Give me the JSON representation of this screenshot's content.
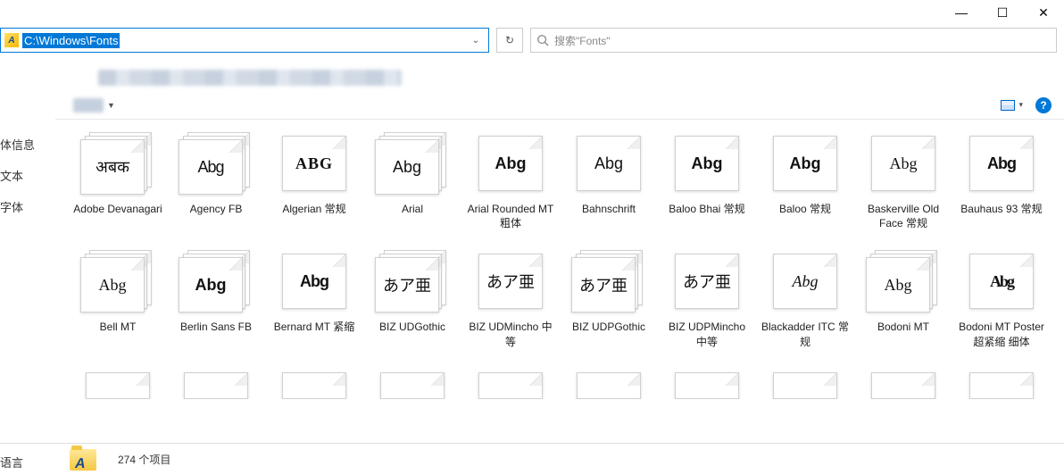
{
  "window": {
    "minimize": "—",
    "maximize": "☐",
    "close": "✕"
  },
  "address": {
    "path": "C:\\Windows\\Fonts"
  },
  "refresh": "↻",
  "search": {
    "placeholder": "搜索\"Fonts\""
  },
  "sidebar": {
    "items": [
      "体信息",
      "文本",
      "字体"
    ],
    "bottom": "语言"
  },
  "toolbar": {
    "view_drop": "▾",
    "help": "?"
  },
  "fonts": [
    {
      "label": "Adobe Devanagari",
      "sample": "अबक",
      "cls": "f-dev",
      "stack": true
    },
    {
      "label": "Agency FB",
      "sample": "Abg",
      "cls": "f-agency",
      "stack": true
    },
    {
      "label": "Algerian 常规",
      "sample": "ABG",
      "cls": "f-algerian",
      "stack": false
    },
    {
      "label": "Arial",
      "sample": "Abg",
      "cls": "f-arial",
      "stack": true
    },
    {
      "label": "Arial Rounded MT 粗体",
      "sample": "Abg",
      "cls": "f-arialr",
      "stack": false
    },
    {
      "label": "Bahnschrift",
      "sample": "Abg",
      "cls": "f-bahn",
      "stack": false
    },
    {
      "label": "Baloo Bhai 常规",
      "sample": "Abg",
      "cls": "f-baloo",
      "stack": false
    },
    {
      "label": "Baloo 常规",
      "sample": "Abg",
      "cls": "f-baloob",
      "stack": false
    },
    {
      "label": "Baskerville Old Face 常规",
      "sample": "Abg",
      "cls": "f-bask",
      "stack": false
    },
    {
      "label": "Bauhaus 93 常规",
      "sample": "Abg",
      "cls": "f-bauhaus",
      "stack": false
    },
    {
      "label": "Bell MT",
      "sample": "Abg",
      "cls": "f-bell",
      "stack": true
    },
    {
      "label": "Berlin Sans FB",
      "sample": "Abg",
      "cls": "f-berlin",
      "stack": true
    },
    {
      "label": "Bernard MT 紧缩",
      "sample": "Abg",
      "cls": "f-bernard",
      "stack": false
    },
    {
      "label": "BIZ UDGothic",
      "sample": "あア亜",
      "cls": "f-biz",
      "stack": true
    },
    {
      "label": "BIZ UDMincho 中等",
      "sample": "あア亜",
      "cls": "f-bizm",
      "stack": false
    },
    {
      "label": "BIZ UDPGothic",
      "sample": "あア亜",
      "cls": "f-biz",
      "stack": true
    },
    {
      "label": "BIZ UDPMincho 中等",
      "sample": "あア亜",
      "cls": "f-bizm",
      "stack": false
    },
    {
      "label": "Blackadder ITC 常规",
      "sample": "Abg",
      "cls": "f-black",
      "stack": false
    },
    {
      "label": "Bodoni MT",
      "sample": "Abg",
      "cls": "f-bodoni",
      "stack": true
    },
    {
      "label": "Bodoni MT Poster 超紧缩 细体",
      "sample": "Abg",
      "cls": "f-bodonip",
      "stack": false
    }
  ],
  "partial_count": 10,
  "status": {
    "count_text": "274 个项目"
  }
}
